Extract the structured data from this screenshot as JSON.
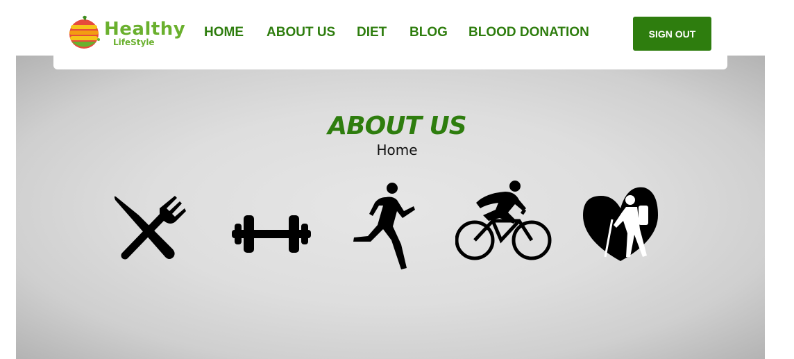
{
  "logo": {
    "title": "Healthy",
    "subtitle": "LifeStyle"
  },
  "nav": {
    "items": [
      {
        "label": "HOME"
      },
      {
        "label": "ABOUT US"
      },
      {
        "label": "DIET"
      },
      {
        "label": "BLOG"
      },
      {
        "label": "BLOOD DONATION"
      }
    ],
    "signout_label": "SIGN OUT"
  },
  "hero": {
    "title": "ABOUT US",
    "breadcrumb": "Home",
    "icons": [
      "fork-knife-icon",
      "dumbbell-icon",
      "runner-icon",
      "cyclist-icon",
      "heart-hiker-icon"
    ]
  },
  "colors": {
    "brand_green": "#2e7d0e",
    "logo_green": "#6ab02e"
  }
}
